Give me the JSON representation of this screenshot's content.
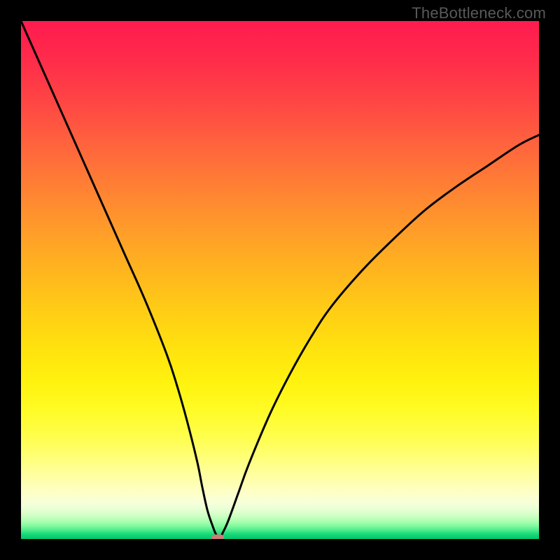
{
  "watermark": "TheBottleneck.com",
  "chart_data": {
    "type": "line",
    "title": "",
    "xlabel": "",
    "ylabel": "",
    "xlim": [
      0,
      100
    ],
    "ylim": [
      0,
      100
    ],
    "grid": false,
    "legend": false,
    "series": [
      {
        "name": "curve",
        "x": [
          0,
          4,
          8,
          12,
          16,
          20,
          24,
          28,
          30,
          32,
          34,
          35,
          36,
          37,
          37.5,
          38,
          38.5,
          39,
          40,
          42,
          44,
          48,
          52,
          56,
          60,
          66,
          72,
          78,
          84,
          90,
          96,
          100
        ],
        "y": [
          100,
          91,
          82,
          73,
          64,
          55,
          46,
          36,
          30,
          23,
          15,
          10,
          5.5,
          2.5,
          1.2,
          0.4,
          0.4,
          1.3,
          3.5,
          9,
          14.5,
          24,
          32,
          39,
          45,
          52,
          58,
          63.5,
          68,
          72,
          76,
          78
        ]
      }
    ],
    "marker": {
      "x": 38,
      "y": 0.2,
      "color": "#cf7b78"
    },
    "gradient_bands": [
      {
        "y": 100,
        "color": "#ff1b4f"
      },
      {
        "y": 92,
        "color": "#ff2d4a"
      },
      {
        "y": 84,
        "color": "#ff4744"
      },
      {
        "y": 76,
        "color": "#ff643d"
      },
      {
        "y": 68,
        "color": "#ff8034"
      },
      {
        "y": 60,
        "color": "#ff9b2a"
      },
      {
        "y": 52,
        "color": "#ffb41f"
      },
      {
        "y": 44,
        "color": "#ffcd15"
      },
      {
        "y": 36,
        "color": "#ffe40e"
      },
      {
        "y": 30,
        "color": "#fff30f"
      },
      {
        "y": 25,
        "color": "#fffb25"
      },
      {
        "y": 20,
        "color": "#fffe4a"
      },
      {
        "y": 16,
        "color": "#ffff75"
      },
      {
        "y": 13,
        "color": "#ffff9a"
      },
      {
        "y": 10,
        "color": "#feffba"
      },
      {
        "y": 8,
        "color": "#fcffd2"
      },
      {
        "y": 6.5,
        "color": "#f2ffda"
      },
      {
        "y": 5.3,
        "color": "#e0ffcf"
      },
      {
        "y": 4.3,
        "color": "#c8ffc0"
      },
      {
        "y": 3.4,
        "color": "#aaffb0"
      },
      {
        "y": 2.6,
        "color": "#85fba0"
      },
      {
        "y": 1.9,
        "color": "#5af090"
      },
      {
        "y": 1.3,
        "color": "#30e281"
      },
      {
        "y": 0.8,
        "color": "#14d576"
      },
      {
        "y": 0.0,
        "color": "#00c86c"
      }
    ]
  }
}
